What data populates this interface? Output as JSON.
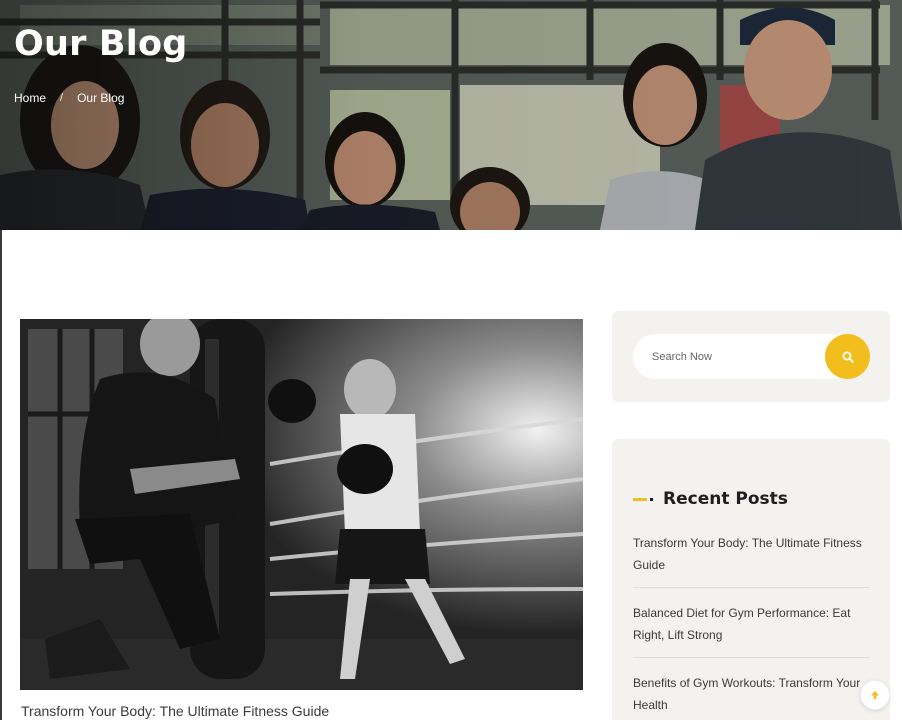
{
  "hero": {
    "title": "Our Blog",
    "breadcrumb": [
      {
        "label": "Home"
      },
      {
        "label": "/"
      },
      {
        "label": "Our Blog"
      }
    ]
  },
  "post": {
    "title": "Transform Your Body: The Ultimate Fitness Guide",
    "image_icon": "boxing-training-photo"
  },
  "search": {
    "placeholder": "Search Now",
    "button_icon": "search-icon"
  },
  "recent_posts": {
    "heading": "Recent Posts",
    "items": [
      {
        "label": "Transform Your Body: The Ultimate Fitness Guide"
      },
      {
        "label": "Balanced Diet for Gym Performance: Eat Right, Lift Strong"
      },
      {
        "label": "Benefits of Gym Workouts: Transform Your Health"
      }
    ]
  },
  "scroll_top": {
    "icon": "arrow-up-icon"
  },
  "colors": {
    "accent": "#f2be1e",
    "card_bg": "#f4f2ee",
    "text_dark": "#1e1e1e"
  }
}
